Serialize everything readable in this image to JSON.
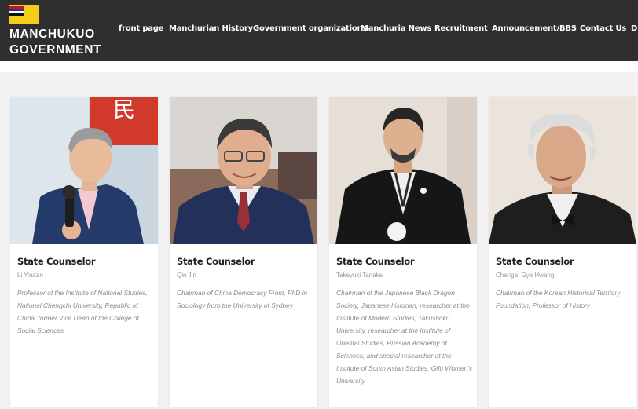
{
  "site": {
    "logo_line1": "MANCHUKUO",
    "logo_line2": "GOVERNMENT"
  },
  "nav": [
    {
      "label": "front page"
    },
    {
      "label": "Manchurian History"
    },
    {
      "label": "Government organizations"
    },
    {
      "label": "Manchuria News"
    },
    {
      "label": "Recruitment"
    },
    {
      "label": "Announcement/BBS"
    },
    {
      "label": "Contact Us"
    },
    {
      "label": "D"
    }
  ],
  "cards": [
    {
      "title": "State Counselor",
      "name": "Li Youtan",
      "description": "Professor of the Institute of National Studies, National Chengchi University, Republic of China, former Vice Dean of the College of Social Sciences"
    },
    {
      "title": "State Counselor",
      "name": "Qin Jin",
      "description": "Chairman of China Democracy Front, PhD in Sociology from the University of Sydney"
    },
    {
      "title": "State Counselor",
      "name": "Takeyuki Tanaka",
      "description": "Chairman of the Japanese Black Dragon Society, Japanese historian, researcher at the Institute of Modern Studies, Takushoku University, researcher at the Institute of Oriental Studies, Russian Academy of Sciences, and special researcher at the Institute of South Asian Studies, Gifu Women's University"
    },
    {
      "title": "State Counselor",
      "name": "Change, Gye Hwang",
      "description": "Chairman of the Korean Historical Territory Foundation, Professor of History"
    }
  ],
  "colors": {
    "header_bg": "#2f2f2f",
    "page_bg": "#f2f2f2",
    "card_bg": "#ffffff",
    "flag_yellow": "#f2cd1a"
  },
  "background_sign": "民"
}
